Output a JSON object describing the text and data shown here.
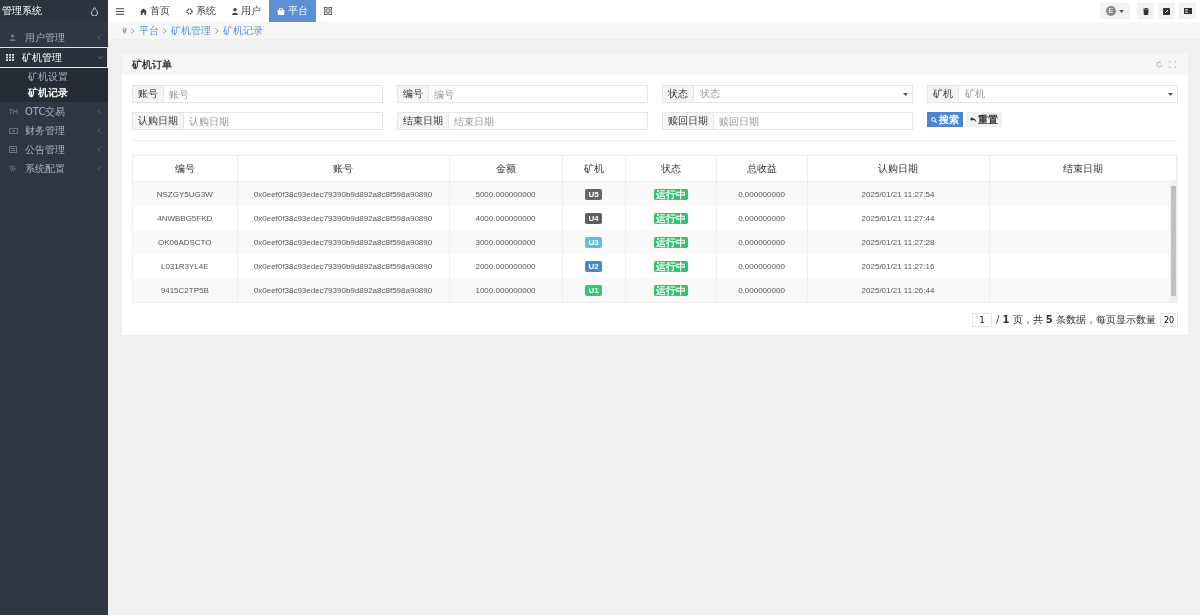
{
  "sidebar": {
    "title": "管理系统",
    "items": [
      {
        "label": "用户管理",
        "expanded": false,
        "selected": false
      },
      {
        "label": "矿机管理",
        "expanded": true,
        "selected": true,
        "children": [
          {
            "label": "矿机设置",
            "selected": false
          },
          {
            "label": "矿机记录",
            "selected": true
          }
        ]
      },
      {
        "label": "OTC交易",
        "expanded": false,
        "selected": false
      },
      {
        "label": "财务管理",
        "expanded": false,
        "selected": false
      },
      {
        "label": "公告管理",
        "expanded": false,
        "selected": false
      },
      {
        "label": "系统配置",
        "expanded": false,
        "selected": false
      }
    ]
  },
  "topbar": {
    "tabs": [
      {
        "label": "首页",
        "selected": false
      },
      {
        "label": "系统",
        "selected": false
      },
      {
        "label": "用户",
        "selected": false
      },
      {
        "label": "平台",
        "selected": true
      }
    ],
    "avatar": "E"
  },
  "breadcrumb": [
    "平台",
    "矿机管理",
    "矿机记录"
  ],
  "panel": {
    "title": "矿机订单",
    "filters": [
      {
        "label": "账号",
        "placeholder": "账号",
        "kind": "text"
      },
      {
        "label": "编号",
        "placeholder": "编号",
        "kind": "text"
      },
      {
        "label": "状态",
        "placeholder": "状态",
        "kind": "select"
      },
      {
        "label": "矿机",
        "placeholder": "矿机",
        "kind": "select"
      },
      {
        "label": "认购日期",
        "placeholder": "认购日期",
        "kind": "text"
      },
      {
        "label": "结束日期",
        "placeholder": "结束日期",
        "kind": "text"
      },
      {
        "label": "赎回日期",
        "placeholder": "赎回日期",
        "kind": "text"
      }
    ],
    "buttons": [
      {
        "label": "搜索",
        "kind": "primary"
      },
      {
        "label": "重置",
        "kind": "default"
      }
    ],
    "table": {
      "columns": [
        "编号",
        "账号",
        "金额",
        "矿机",
        "状态",
        "总收益",
        "认购日期",
        "结束日期"
      ],
      "rows": [
        {
          "id": "NSZGY5UG3W",
          "account": "0x0eef0f38c93edec79390b9d892a8c8f598a90890",
          "amount": "5000.000000000",
          "miner": "U5",
          "color": "#666666",
          "status": "运行中",
          "profit": "0.000000000",
          "start": "2025/01/21 11:27:54"
        },
        {
          "id": "4NWBBG5FKD",
          "account": "0x0eef0f38c93edec79390b9d892a8c8f598a90890",
          "amount": "4000.000000000",
          "miner": "U4",
          "color": "#5e5e5e",
          "status": "运行中",
          "profit": "0.000000000",
          "start": "2025/01/21 11:27:44"
        },
        {
          "id": "OK06ADSCTO",
          "account": "0x0eef0f38c93edec79390b9d892a8c8f598a90890",
          "amount": "3000.000000000",
          "miner": "U3",
          "color": "#5bc0de",
          "status": "运行中",
          "profit": "0.000000000",
          "start": "2025/01/21 11:27:28"
        },
        {
          "id": "L031R3YL4E",
          "account": "0x0eef0f38c93edec79390b9d892a8c8f598a90890",
          "amount": "2000.000000000",
          "miner": "U2",
          "color": "#428bca",
          "status": "运行中",
          "profit": "0.000000000",
          "start": "2025/01/21 11:27:16"
        },
        {
          "id": "9415C2TP5B",
          "account": "0x0eef0f38c93edec79390b9d892a8c8f598a90890",
          "amount": "1000.000000000",
          "miner": "U1",
          "color": "#2ecc71",
          "status": "运行中",
          "profit": "0.000000000",
          "start": "2025/01/21 11:26:44"
        }
      ]
    },
    "pagination": {
      "page": "1",
      "summary": "/ **1** 页，共 **5** 条数据，每页显示数量",
      "page_size": "20"
    }
  }
}
